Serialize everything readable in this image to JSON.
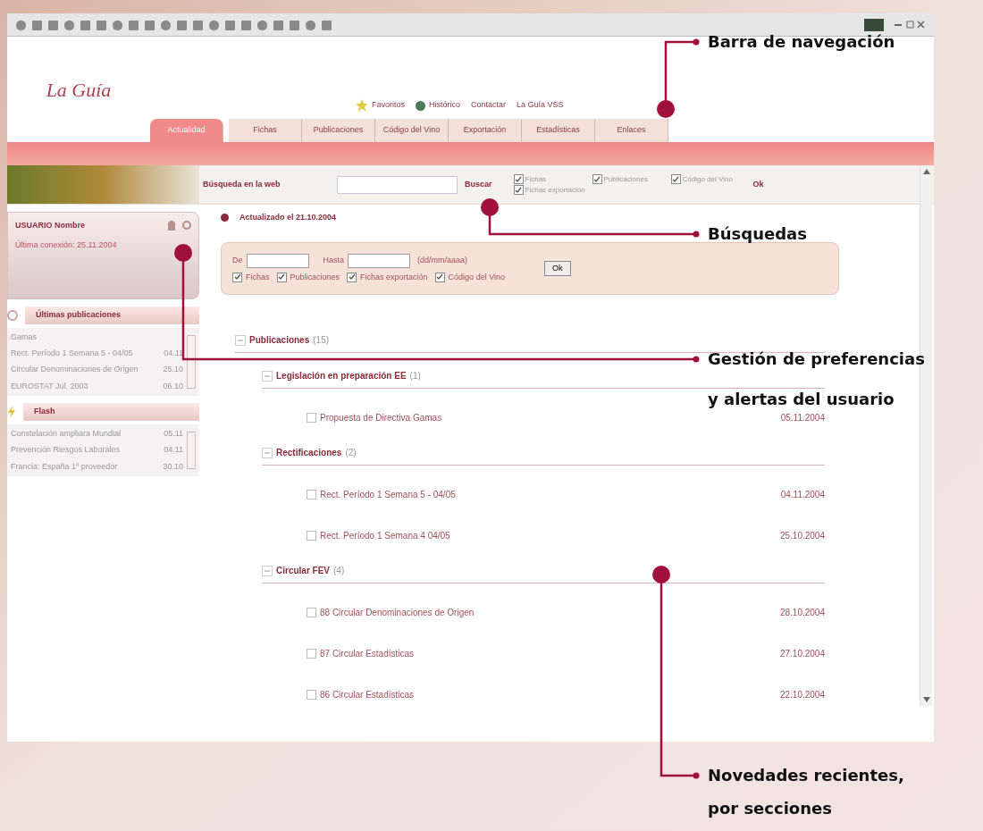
{
  "logo": "La Guía",
  "header_links": [
    {
      "label": "Favoritos"
    },
    {
      "label": "Histórico"
    },
    {
      "label": "Contactar"
    },
    {
      "label": "La Guía VSS"
    }
  ],
  "tabs": [
    {
      "label": "Actualidad",
      "selected": true
    },
    {
      "label": "Fichas",
      "selected": false
    },
    {
      "label": "Publicaciones",
      "selected": false
    },
    {
      "label": "Código del Vino",
      "selected": false
    },
    {
      "label": "Exportación",
      "selected": false
    },
    {
      "label": "Estadísticas",
      "selected": false
    },
    {
      "label": "Enlaces",
      "selected": false
    }
  ],
  "search": {
    "label": "Búsqueda en la web",
    "button": "Buscar",
    "submit": "Ok",
    "options": [
      {
        "label": "Fichas",
        "checked": true
      },
      {
        "label": "Publicaciones",
        "checked": true
      },
      {
        "label": "Código del Vino",
        "checked": true
      },
      {
        "label": "Fichas exportación",
        "checked": true
      }
    ]
  },
  "user_panel": {
    "name": "USUARIO Nombre",
    "last_login": "Última conexión: 25.11.2004"
  },
  "sidebar_sections": [
    {
      "title": "Últimas publicaciones",
      "kind": "publications",
      "items": [
        {
          "title": "Gamas"
        },
        {
          "title": "Rect. Período 1 Semana 5 - 04/05",
          "date": "04.11"
        },
        {
          "title": "Circular Denominaciones de Origen",
          "date": "25.10"
        },
        {
          "title": "EUROSTAT Jul. 2003",
          "date": "06.10"
        }
      ]
    },
    {
      "title": "Flash",
      "kind": "flash",
      "items": [
        {
          "title": "Constelación ampliara Mundial",
          "date": "05.11"
        },
        {
          "title": "Prevención Riesgos Laborales",
          "date": "04.11"
        },
        {
          "title": "Francia: España 1º proveedor",
          "date": "30.10"
        }
      ]
    }
  ],
  "main": {
    "updated": "Actualizado el 21.10.2004",
    "filter": {
      "from_label": "De",
      "to_label": "Hasta",
      "format": "(dd/mm/aaaa)",
      "submit": "Ok",
      "options": [
        {
          "label": "Fichas",
          "checked": true
        },
        {
          "label": "Publicaciones",
          "checked": true
        },
        {
          "label": "Fichas exportación",
          "checked": true
        },
        {
          "label": "Código del Vino",
          "checked": true
        }
      ]
    },
    "tree": [
      {
        "label": "Publicaciones",
        "count": "(15)",
        "expanded": true,
        "children": [
          {
            "label": "Legislación en preparación EE",
            "count": "(1)",
            "expanded": true,
            "children": [
              {
                "label": "Propuesta de Directiva Gamas",
                "date": "05.11.2004",
                "checked": false
              }
            ]
          },
          {
            "label": "Rectificaciones",
            "count": "(2)",
            "expanded": true,
            "children": [
              {
                "label": "Rect. Período 1 Semana 5 - 04/05",
                "date": "04.11.2004",
                "checked": false
              },
              {
                "label": "Rect. Período 1 Semana 4 04/05",
                "date": "25.10.2004",
                "checked": false
              }
            ]
          },
          {
            "label": "Circular FEV",
            "count": "(4)",
            "expanded": true,
            "children": [
              {
                "label": "88 Circular Denominaciones de Origen",
                "date": "28.10.2004",
                "checked": false
              },
              {
                "label": "87 Circular Estadísticas",
                "date": "27.10.2004",
                "checked": false
              },
              {
                "label": "86 Circular Estadísticas",
                "date": "22.10.2004",
                "checked": false
              }
            ]
          }
        ]
      }
    ]
  },
  "callouts": [
    {
      "lines": [
        "Barra de navegación"
      ]
    },
    {
      "lines": [
        "Búsquedas"
      ]
    },
    {
      "lines": [
        "Gestión de preferencias",
        "y alertas del usuario"
      ]
    },
    {
      "lines": [
        "Novedades recientes,",
        "por secciones"
      ]
    }
  ]
}
